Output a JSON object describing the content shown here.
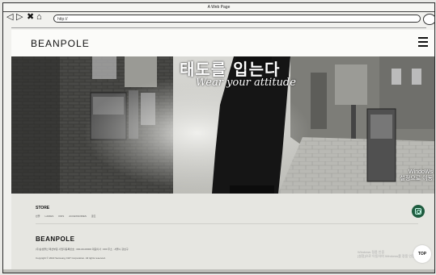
{
  "window": {
    "title": "A Web Page"
  },
  "browser": {
    "back_glyph": "◁",
    "forward_glyph": "▷",
    "stop_glyph": "✖",
    "home_glyph": "⌂",
    "url": "http://"
  },
  "header": {
    "logo": "BEANPOLE"
  },
  "hero": {
    "title": "태도를 입는다",
    "subtitle": "Wear your attitude",
    "corner_text_1": "WindoWs",
    "corner_text_2": "설정으로 이동"
  },
  "footer": {
    "store_title": "STORE",
    "store_links": [
      "빈폴",
      "LADIES",
      "KIDS",
      "ACCESSORIES",
      "골프"
    ],
    "logo": "BEANPOLE",
    "info": "(주)삼성물산 패션부문   사업자등록번호 : 000-00-00000   대표이사 : 000   주소 : 서울시 강남구",
    "copyright": "Copyright © 2022 Samsung C&T Corporation. All rights reserved.",
    "windows_activate_1": "Windows 정품 인증",
    "windows_activate_2": "[설정]으로 이동하여 Windows를 정품 인증합니다.",
    "top_button": "TOP"
  },
  "colors": {
    "accent_green": "#1f5c3f",
    "frame": "#2b2b2b"
  }
}
